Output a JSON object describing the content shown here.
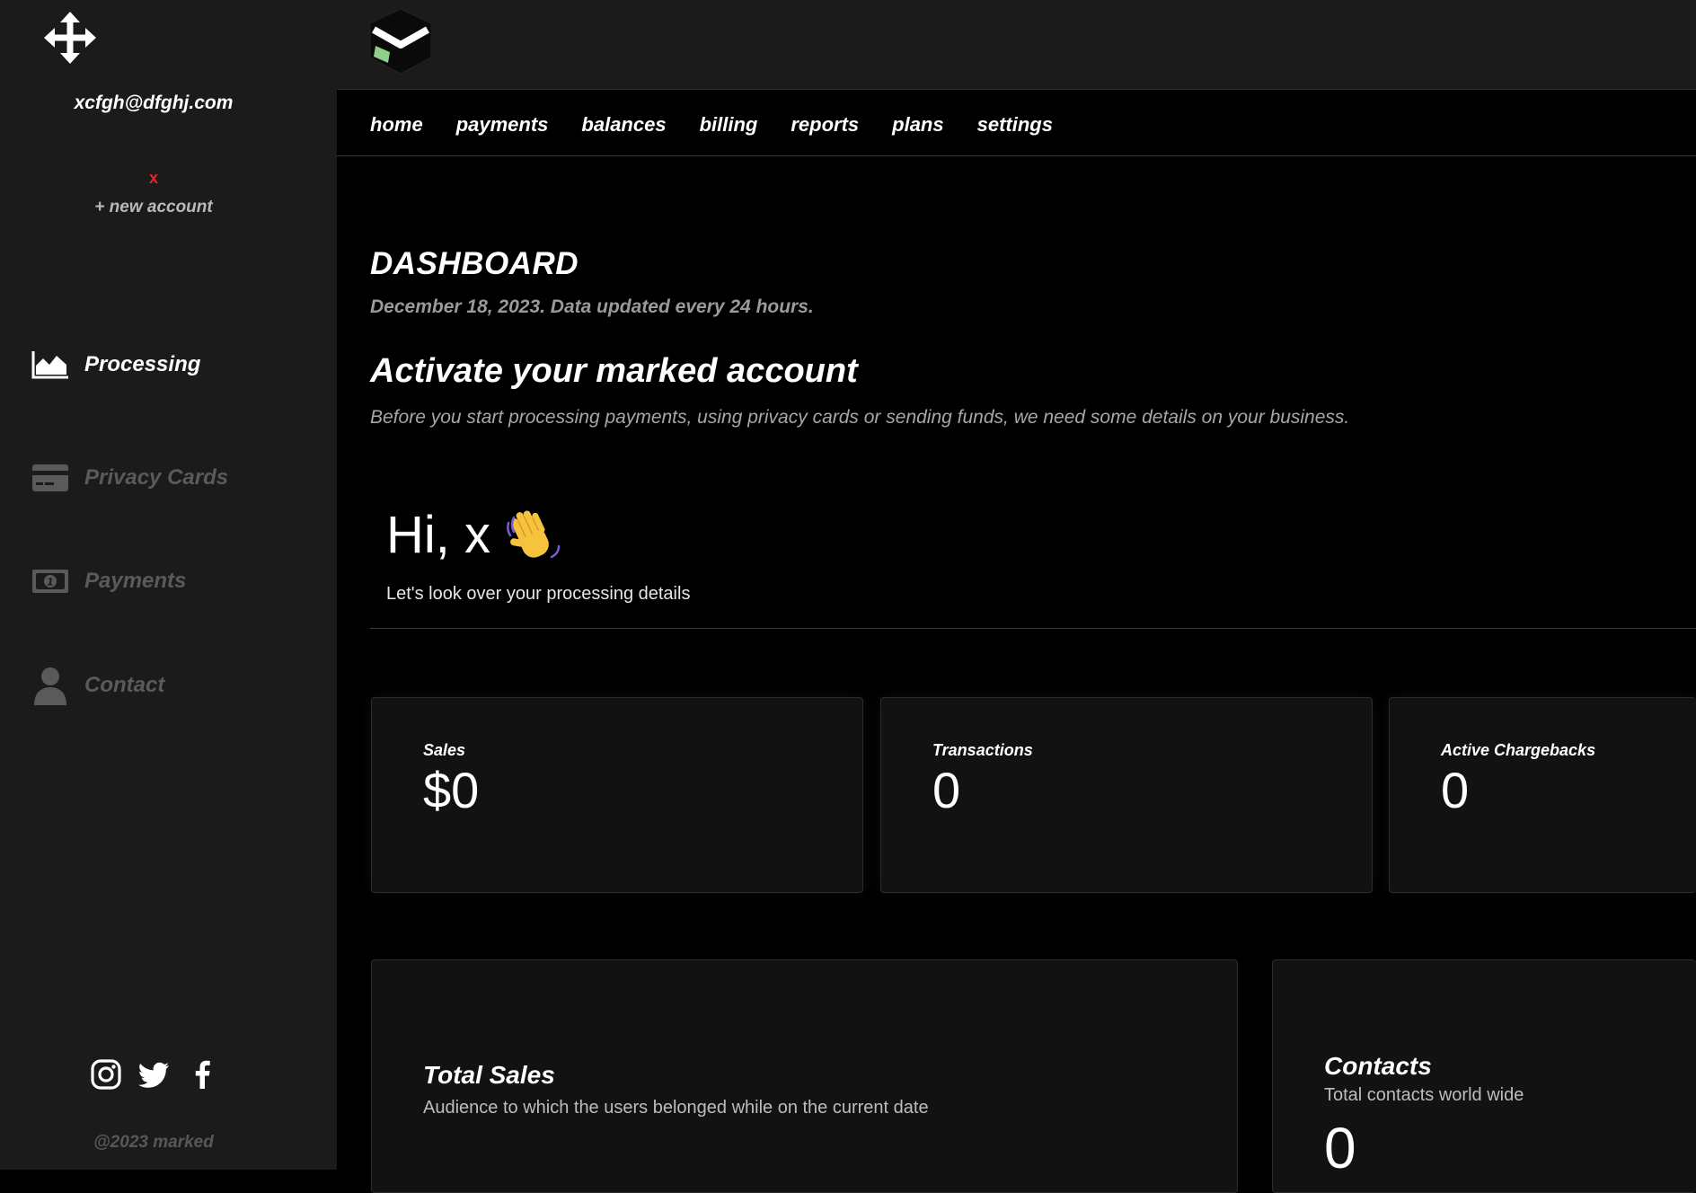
{
  "sidebar": {
    "move_icon": "move-arrows-icon",
    "account_email": "xcfgh@dfghj.com",
    "remove_account": "x",
    "new_account": "+ new account",
    "items": [
      {
        "label": "Processing",
        "icon": "area-chart-icon",
        "active": true
      },
      {
        "label": "Privacy Cards",
        "icon": "credit-card-icon",
        "active": false
      },
      {
        "label": "Payments",
        "icon": "money-bill-icon",
        "active": false
      },
      {
        "label": "Contact",
        "icon": "user-icon",
        "active": false
      }
    ],
    "socials": [
      "instagram-icon",
      "twitter-icon",
      "facebook-icon"
    ],
    "copyright": "@2023 marked"
  },
  "header": {
    "logo": "brand-logo-icon"
  },
  "nav": {
    "items": [
      "home",
      "payments",
      "balances",
      "billing",
      "reports",
      "plans",
      "settings"
    ]
  },
  "dashboard": {
    "title": "DASHBOARD",
    "date": "December 18, 2023. Data updated every 24 hours.",
    "activate_title": "Activate your marked account",
    "activate_desc": "Before you start processing payments, using privacy cards or sending funds, we need some details on your business.",
    "greeting": "Hi, x",
    "greeting_sub": "Let's look over your processing details"
  },
  "stats": [
    {
      "label": "Sales",
      "value": "$0"
    },
    {
      "label": "Transactions",
      "value": "0"
    },
    {
      "label": "Active Chargebacks",
      "value": "0"
    }
  ],
  "total_sales": {
    "title": "Total Sales",
    "subtitle": "Audience to which the users belonged while on the current date"
  },
  "contacts": {
    "title": "Contacts",
    "subtitle": "Total contacts world wide",
    "value": "0"
  },
  "colors": {
    "sidebar_bg": "#1b1b1b",
    "content_bg": "#000000",
    "card_bg": "#121212",
    "danger": "#e0252b",
    "muted": "#5a5a5a",
    "logo_accent": "#8fcf8a"
  }
}
